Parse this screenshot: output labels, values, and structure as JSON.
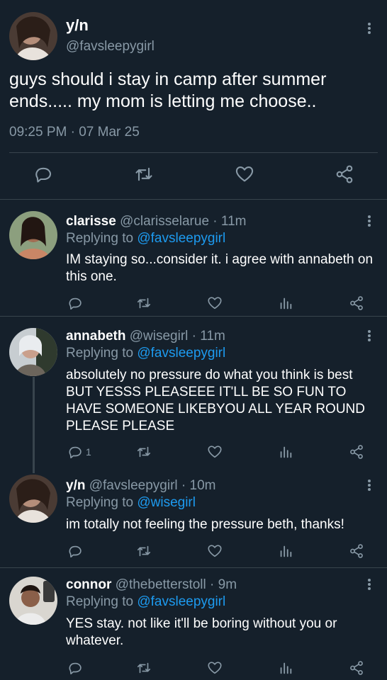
{
  "main_tweet": {
    "name": "y/n",
    "handle": "@favsleepygirl",
    "text": "guys should i stay in camp after summer ends..... my mom is letting me choose..",
    "meta": "09:25 PM · 07 Mar 25"
  },
  "replies": [
    {
      "name": "clarisse",
      "handle": "@clarisselarue",
      "time": " · 11m",
      "replying_label": "Replying to ",
      "replying_to": "@favsleepygirl",
      "text": "IM staying so...consider it. i agree with annabeth on this one.",
      "reply_count": ""
    },
    {
      "name": "annabeth",
      "handle": "@wisegirl",
      "time": " · 11m",
      "replying_label": "Replying to ",
      "replying_to": "@favsleepygirl",
      "text": "absolutely no pressure do what you think is best BUT YESSS PLEASEEE IT'LL BE SO FUN TO HAVE SOMEONE LIKEBYOU ALL YEAR ROUND PLEASE PLEASE",
      "reply_count": "1"
    },
    {
      "name": "y/n",
      "handle": "@favsleepygirl",
      "time": " · 10m",
      "replying_label": "Replying to ",
      "replying_to": "@wisegirl",
      "text": "im totally not feeling the pressure beth, thanks!",
      "reply_count": ""
    },
    {
      "name": "connor",
      "handle": "@thebetterstoll",
      "time": " · 9m",
      "replying_label": "Replying to ",
      "replying_to": "@favsleepygirl",
      "text": "YES stay. not like it'll be boring without you or whatever.",
      "reply_count": ""
    }
  ],
  "icons": {
    "reply": "reply-icon",
    "retweet": "retweet-icon",
    "like": "heart-icon",
    "analytics": "analytics-icon",
    "share": "share-icon",
    "more": "more-vertical-icon"
  },
  "colors": {
    "background": "#15202b",
    "muted": "#8899a6",
    "link": "#1d9bf0",
    "divider": "#38444d"
  }
}
